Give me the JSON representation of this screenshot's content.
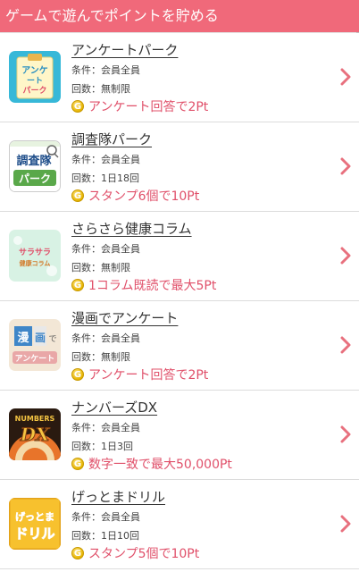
{
  "header": {
    "title": "ゲームで遊んでポイントを貯める"
  },
  "items": [
    {
      "title": "アンケートパーク",
      "condition": "条件：会員全員",
      "count": "回数：無制限",
      "reward": "アンケート回答で2Pt",
      "icon_text": [
        "アンケ",
        "ート",
        "パーク"
      ]
    },
    {
      "title": "調査隊パーク",
      "condition": "条件：会員全員",
      "count": "回数：1日18回",
      "reward": "スタンプ6個で10Pt",
      "icon_text": [
        "調査隊",
        "パーク"
      ]
    },
    {
      "title": "さらさら健康コラム",
      "condition": "条件：会員全員",
      "count": "回数：無制限",
      "reward": "1コラム既読で最大5Pt",
      "icon_text": [
        "サラサラ",
        "健康コラム"
      ]
    },
    {
      "title": "漫画でアンケート",
      "condition": "条件：会員全員",
      "count": "回数：無制限",
      "reward": "アンケート回答で2Pt",
      "icon_text": [
        "漫",
        "画",
        "で",
        "アンケート"
      ]
    },
    {
      "title": "ナンバーズDX",
      "condition": "条件：会員全員",
      "count": "回数：1日3回",
      "reward": "数字一致で最大50,000Pt",
      "icon_text": [
        "NUMBERS",
        "DX"
      ]
    },
    {
      "title": "げっとまドリル",
      "condition": "条件：会員全員",
      "count": "回数：1日10回",
      "reward": "スタンプ5個で10Pt",
      "icon_text": [
        "げっとま",
        "ドリル"
      ]
    }
  ],
  "coin_label": "G",
  "colors": {
    "header": "#f0697a",
    "reward": "#e0506a",
    "chevron": "#e8707e"
  }
}
